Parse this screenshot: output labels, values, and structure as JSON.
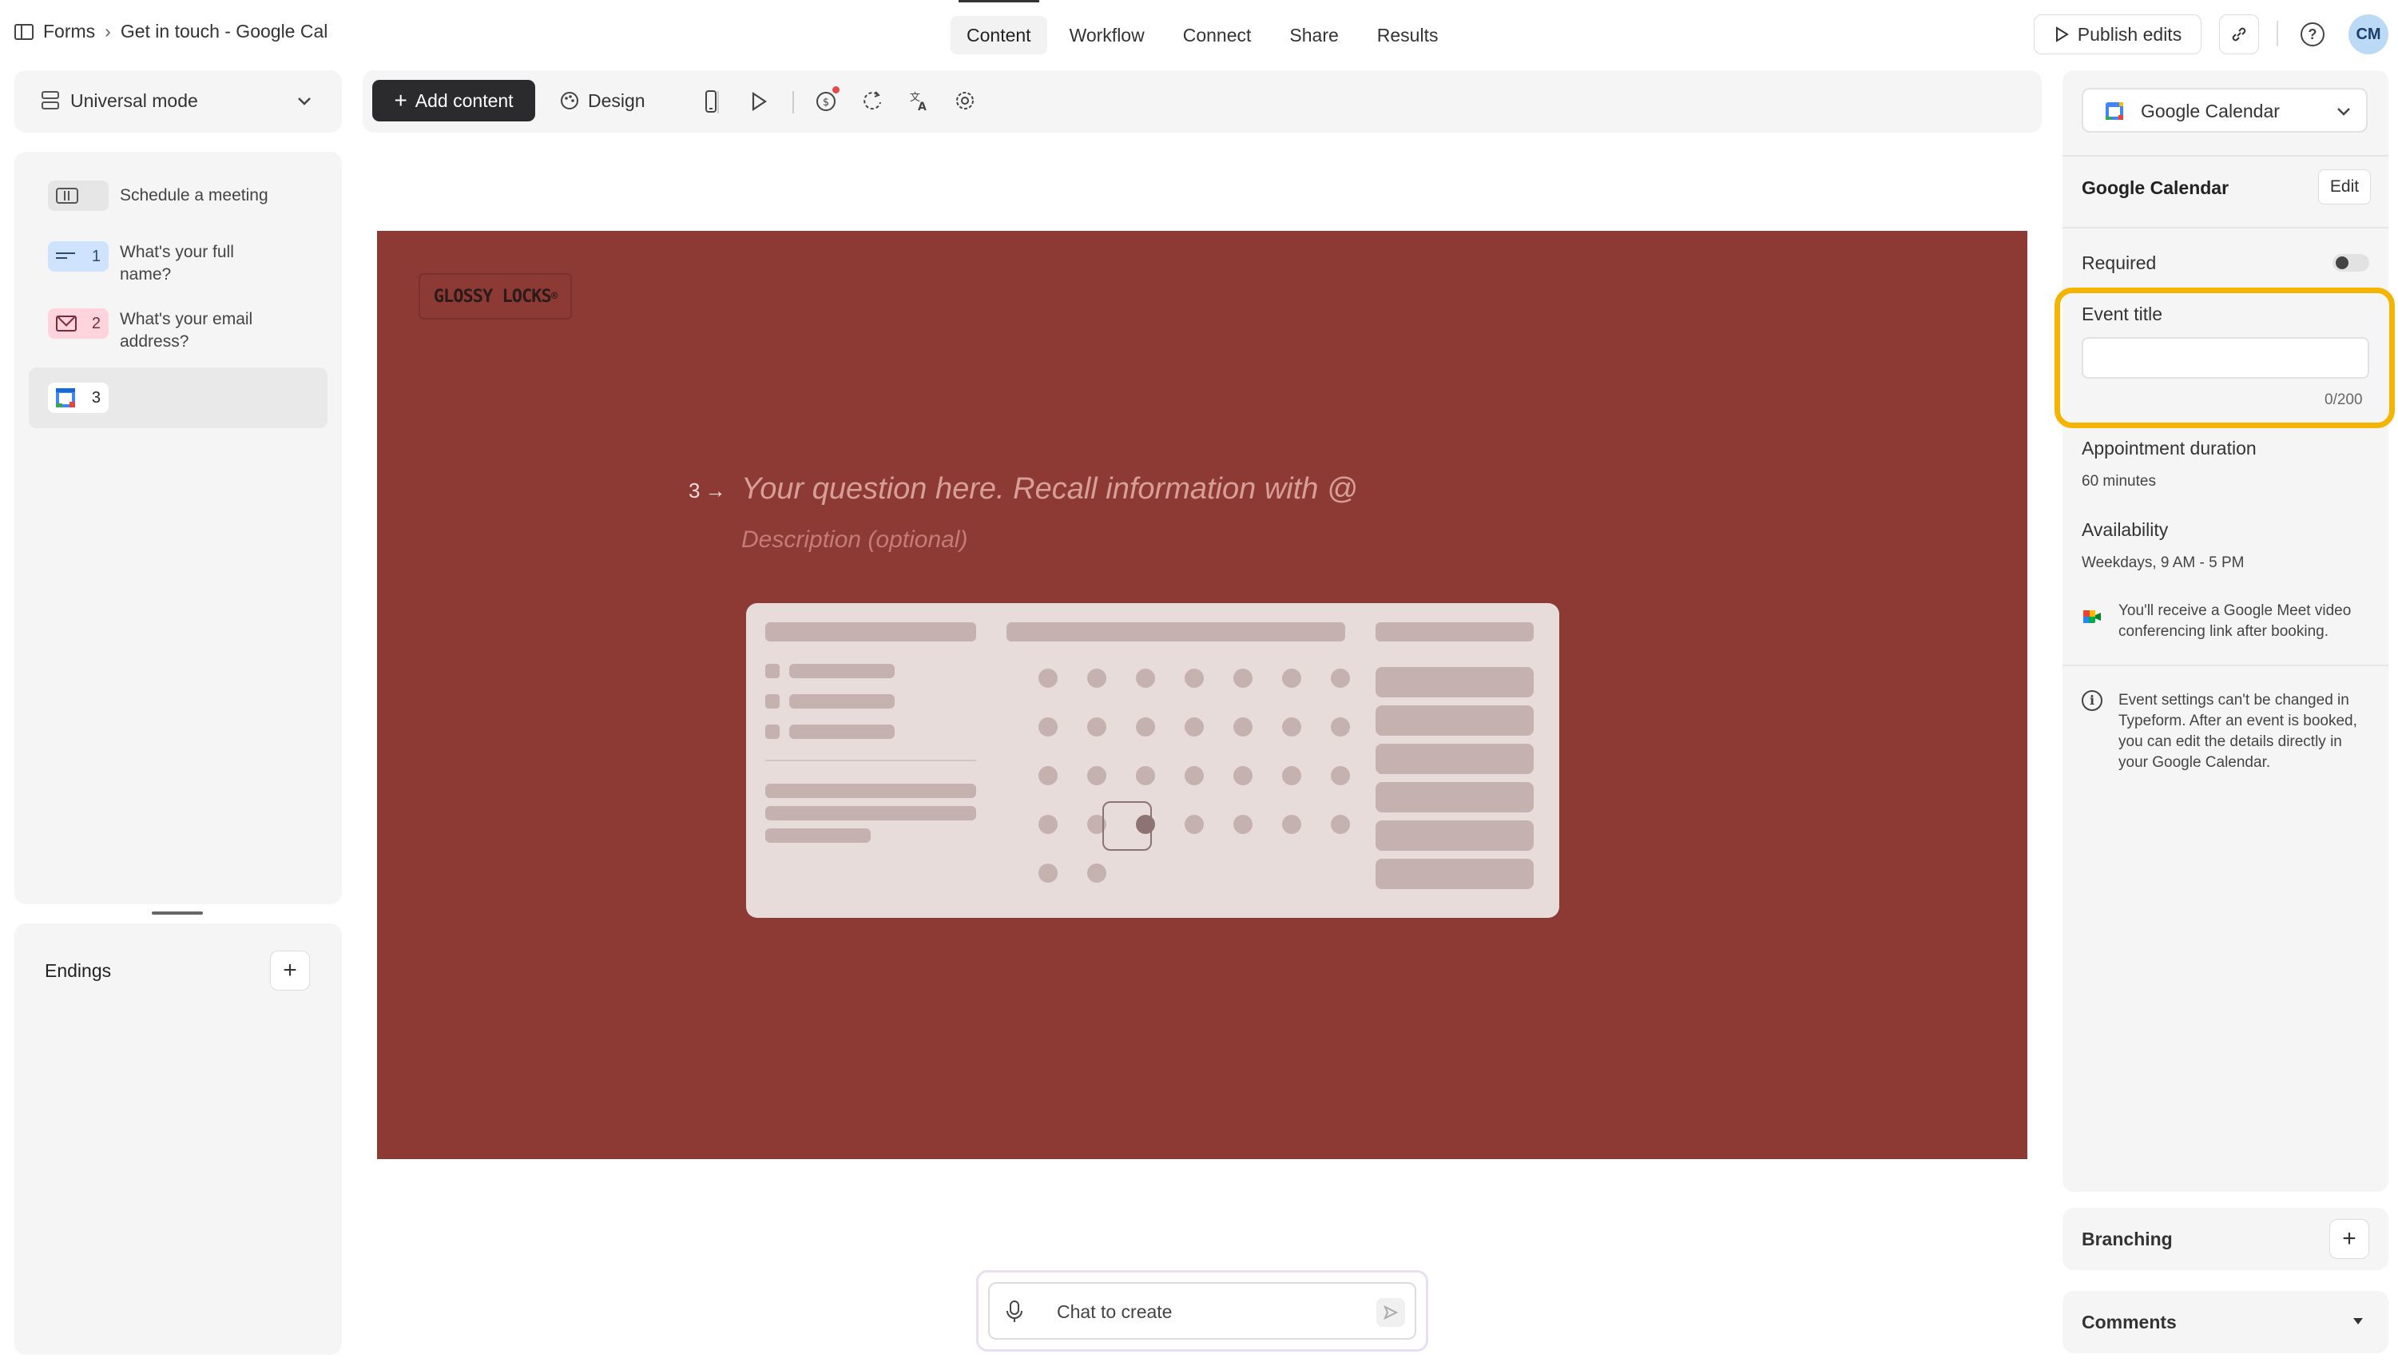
{
  "breadcrumb": {
    "root": "Forms",
    "separator": "›",
    "current": "Get in touch - Google Cal"
  },
  "nav": {
    "tabs": [
      {
        "label": "Content",
        "active": true
      },
      {
        "label": "Workflow",
        "active": false
      },
      {
        "label": "Connect",
        "active": false
      },
      {
        "label": "Share",
        "active": false
      },
      {
        "label": "Results",
        "active": false
      }
    ]
  },
  "header": {
    "publish_label": "Publish edits",
    "avatar_initials": "CM"
  },
  "left": {
    "mode_label": "Universal mode",
    "questions": [
      {
        "number": "",
        "label": "Schedule a meeting",
        "color": "#e6e6e6"
      },
      {
        "number": "1",
        "label": "What's your full name?",
        "color": "#cfe3ff"
      },
      {
        "number": "2",
        "label": "What's your email address?",
        "color": "#ffd4dc"
      },
      {
        "number": "3",
        "label": "",
        "color": "#ffffff"
      }
    ],
    "endings_label": "Endings"
  },
  "toolbar": {
    "add_content_label": "Add content",
    "design_label": "Design"
  },
  "canvas": {
    "bg_color": "#8d3a35",
    "logo_text": "GLOSSY LOCKS",
    "logo_mark": "®",
    "question_number": "3",
    "question_arrow": "→",
    "question_placeholder": "Your question here. Recall information with @",
    "description_placeholder": "Description (optional)"
  },
  "chat": {
    "placeholder": "Chat to create"
  },
  "right": {
    "block_type": "Google Calendar",
    "section_title": "Google Calendar",
    "edit_label": "Edit",
    "required_label": "Required",
    "required_on": false,
    "event_title_label": "Event title",
    "event_title_value": "",
    "event_title_counter": "0/200",
    "duration_label": "Appointment duration",
    "duration_value": "60 minutes",
    "availability_label": "Availability",
    "availability_value": "Weekdays, 9 AM - 5 PM",
    "meet_note": "You'll receive a Google Meet video conferencing link after booking.",
    "info_note": "Event settings can't be changed in Typeform. After an event is booked, you can edit the details directly in your Google Calendar.",
    "branching_label": "Branching",
    "comments_label": "Comments",
    "highlight_color": "#f5b400"
  }
}
